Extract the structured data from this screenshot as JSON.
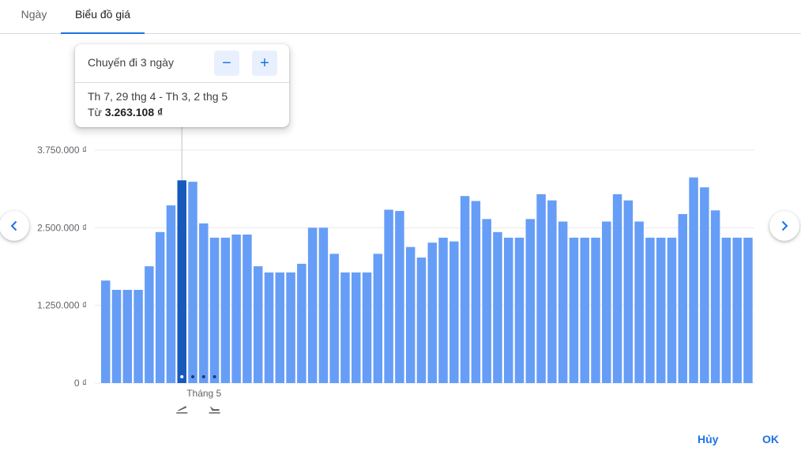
{
  "tabs": [
    {
      "label": "Ngày",
      "active": false
    },
    {
      "label": "Biểu đồ giá",
      "active": true
    }
  ],
  "tooltip": {
    "title": "Chuyến đi 3 ngày",
    "minus_label": "−",
    "plus_label": "+",
    "dates": "Th 7, 29 thg 4 - Th 3, 2 thg 5",
    "price_prefix": "Từ",
    "price": "3.263.108 ₫"
  },
  "nav": {
    "prev_icon": "chevron-left-icon",
    "next_icon": "chevron-right-icon"
  },
  "footer": {
    "cancel_label": "Hủy",
    "ok_label": "OK"
  },
  "colors": {
    "bar": "#669df6",
    "bar_selected": "#185abc",
    "accent": "#1a73e8",
    "grid": "#e8eaed"
  },
  "chart_data": {
    "type": "bar",
    "yticks": [
      {
        "value": 0,
        "label": "0 ₫"
      },
      {
        "value": 1250000,
        "label": "1.250.000 ₫"
      },
      {
        "value": 2500000,
        "label": "2.500.000 ₫"
      },
      {
        "value": 3750000,
        "label": "3.750.000 ₫"
      }
    ],
    "ylim": [
      0,
      3750000
    ],
    "month_label": "Tháng 5",
    "selected_index": 7,
    "departure_icon": "takeoff-icon",
    "return_icon": "landing-icon",
    "values": [
      1650000,
      1500000,
      1500000,
      1500000,
      1880000,
      2430000,
      2860000,
      3263108,
      3240000,
      2570000,
      2340000,
      2340000,
      2390000,
      2390000,
      1880000,
      1780000,
      1780000,
      1780000,
      1920000,
      2500000,
      2500000,
      2080000,
      1780000,
      1780000,
      1780000,
      2080000,
      2790000,
      2770000,
      2190000,
      2020000,
      2260000,
      2340000,
      2280000,
      3010000,
      2930000,
      2640000,
      2430000,
      2340000,
      2340000,
      2640000,
      3040000,
      2940000,
      2600000,
      2340000,
      2340000,
      2340000,
      2600000,
      3040000,
      2940000,
      2600000,
      2340000,
      2340000,
      2340000,
      2720000,
      3310000,
      3150000,
      2780000,
      2340000,
      2340000,
      2340000
    ]
  }
}
